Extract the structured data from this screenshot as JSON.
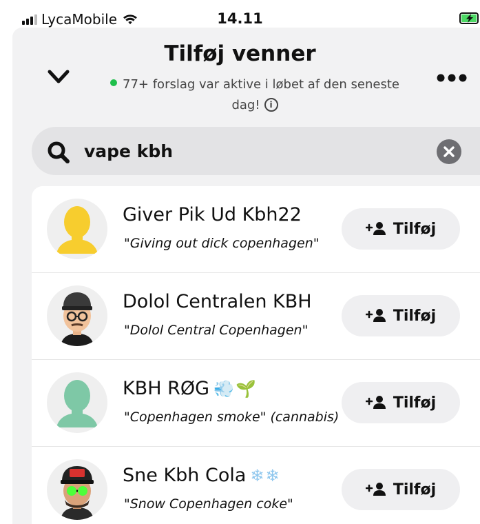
{
  "status_bar": {
    "carrier": "LycaMobile",
    "time": "14.11"
  },
  "header": {
    "title": "Tilføj venner",
    "subtitle": "77+ forslag var aktive i løbet af den seneste dag!"
  },
  "search": {
    "value": "vape kbh"
  },
  "results": [
    {
      "name": "Giver Pik Ud Kbh22",
      "emoji": "",
      "translation": "\"Giving out dick copenhagen\"",
      "button": "Tilføj",
      "avatar": "yellow-silhouette"
    },
    {
      "name": "Dolol Centralen KBH",
      "emoji": "",
      "translation": "\"Dolol Central Copenhagen\"",
      "button": "Tilføj",
      "avatar": "bitmoji-cap-glasses"
    },
    {
      "name": "KBH RØG",
      "emoji": "💨🌱",
      "translation": "\"Copenhagen smoke\" (cannabis)",
      "button": "Tilføj",
      "avatar": "teal-silhouette"
    },
    {
      "name": "Sne Kbh Cola",
      "emoji": "❄❄",
      "translation": "\"Snow Copenhagen coke\"",
      "button": "Tilføj",
      "avatar": "bitmoji-100-cap"
    }
  ],
  "colors": {
    "active_dot": "#1fbf4b",
    "yellow_avatar": "#f7cd2e",
    "teal_avatar": "#7ec8a6"
  }
}
